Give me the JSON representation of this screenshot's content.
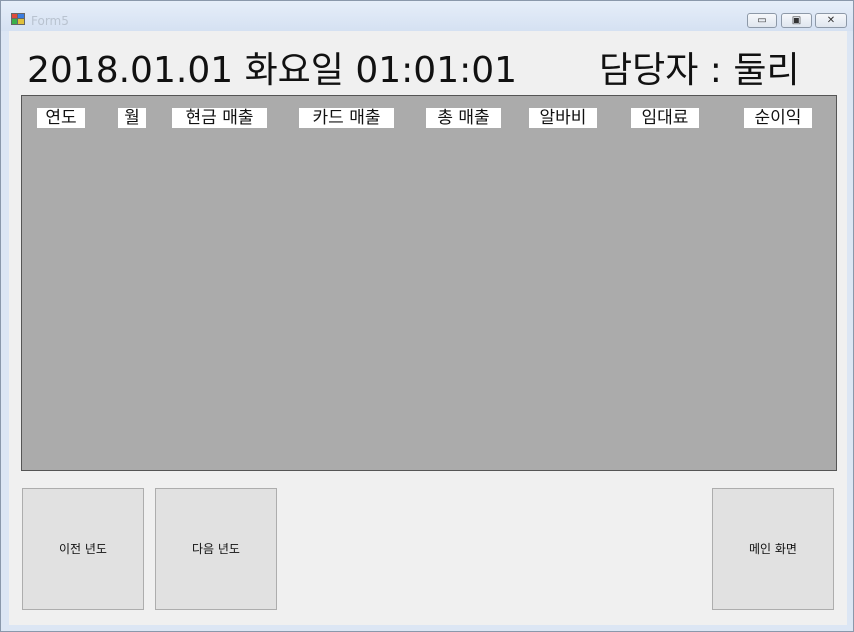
{
  "window": {
    "title": "Form5",
    "minimize_glyph": "▭",
    "maximize_glyph": "▣",
    "close_glyph": "✕"
  },
  "header": {
    "datetime": "2018.01.01 화요일 01:01:01",
    "manager": "담당자 : 둘리"
  },
  "table": {
    "columns": [
      "연도",
      "월",
      "현금 매출",
      "카드 매출",
      "총 매출",
      "알바비",
      "임대료",
      "순이익"
    ],
    "rows": []
  },
  "buttons": {
    "prev_year": "이전 년도",
    "next_year": "다음 년도",
    "main_screen": "메인 화면"
  },
  "colors": {
    "grid_background": "#ababab",
    "button_background": "#e1e1e1",
    "form_background": "#f0f0f0"
  },
  "icons": {
    "app": "app-icon",
    "minimize": "minimize-icon",
    "maximize": "maximize-icon",
    "close": "close-icon"
  }
}
